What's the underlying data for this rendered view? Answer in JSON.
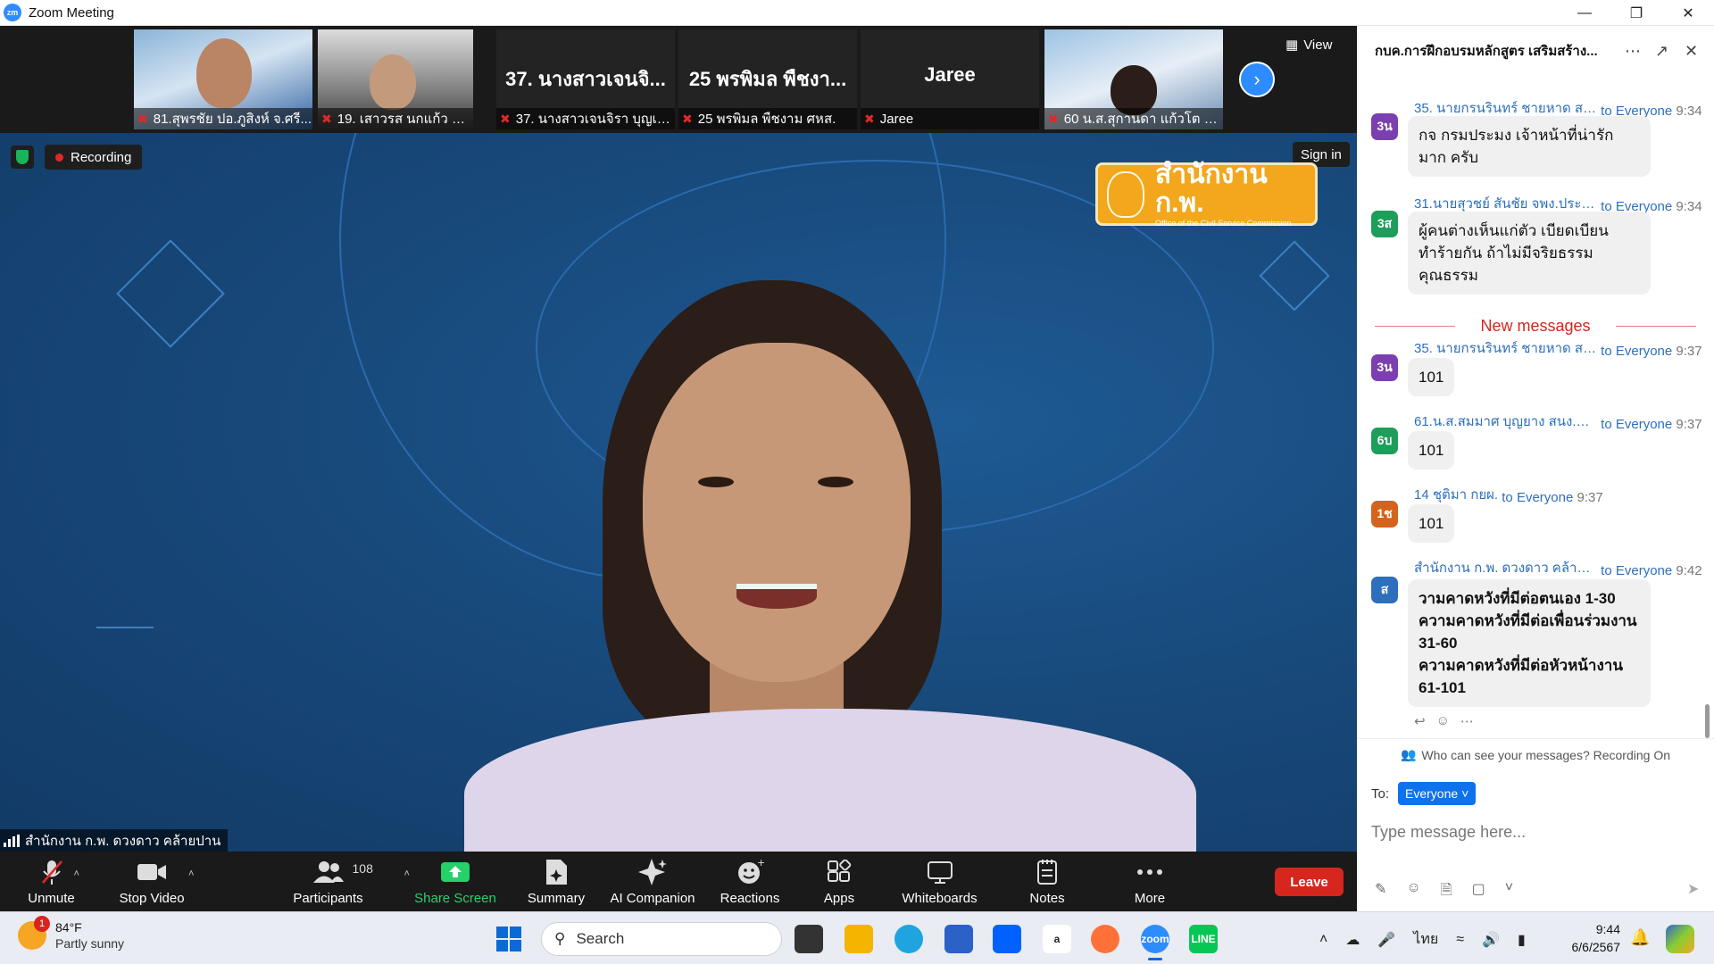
{
  "window": {
    "title": "Zoom Meeting",
    "app_logo_text": "zm",
    "controls": [
      "minimize-icon",
      "restore-icon",
      "close-icon"
    ]
  },
  "thumbnails": [
    {
      "id": "t1",
      "label": "81.สุพรชัย ปอ.ภูสิงห์ จ.ศรี...",
      "has_video": true,
      "muted": true
    },
    {
      "id": "t2",
      "label": "19. เสาวรส นกแก้ว  กอส.",
      "has_video": true,
      "muted": true
    },
    {
      "id": "t3",
      "big_name": "37. นางสาวเจนจิ...",
      "label": "37. นางสาวเจนจิรา บุญเลิ...",
      "has_video": false,
      "muted": true
    },
    {
      "id": "t4",
      "big_name": "25 พรพิมล  พืชงา...",
      "label": "25 พรพิมล  พืชงาม ศหส.",
      "has_video": false,
      "muted": true
    },
    {
      "id": "t5",
      "big_name": "Jaree",
      "label": "Jaree",
      "has_video": false,
      "muted": true
    },
    {
      "id": "t6",
      "label": "60 น.ส.สุกานดา แก้วโต ส...",
      "has_video": true,
      "muted": true
    }
  ],
  "strip": {
    "view_label": "View",
    "next_icon": "chevron-right-icon"
  },
  "main": {
    "recording_label": "Recording",
    "sign_in_label": "Sign in",
    "logo_text_th": "สำนักงาน ก.พ.",
    "logo_text_en": "Office of the Civil Service Commission",
    "speaker_name": "สำนักงาน ก.พ. ดวงดาว คล้ายปาน"
  },
  "toolbar": {
    "items": [
      {
        "key": "unmute",
        "label": "Unmute",
        "icon": "mic-muted-icon",
        "caret": true
      },
      {
        "key": "video",
        "label": "Stop Video",
        "icon": "video-camera-icon",
        "caret": true
      },
      {
        "key": "participants",
        "label": "Participants",
        "icon": "people-icon",
        "count": "108",
        "caret": true
      },
      {
        "key": "share",
        "label": "Share Screen",
        "icon": "share-screen-icon",
        "highlight": "#26d06a"
      },
      {
        "key": "summary",
        "label": "Summary",
        "icon": "summary-icon"
      },
      {
        "key": "ai",
        "label": "AI Companion",
        "icon": "sparkle-icon"
      },
      {
        "key": "reactions",
        "label": "Reactions",
        "icon": "smile-plus-icon"
      },
      {
        "key": "apps",
        "label": "Apps",
        "icon": "apps-icon"
      },
      {
        "key": "whiteboards",
        "label": "Whiteboards",
        "icon": "whiteboard-icon"
      },
      {
        "key": "notes",
        "label": "Notes",
        "icon": "notes-icon"
      },
      {
        "key": "more",
        "label": "More",
        "icon": "more-dots-icon"
      }
    ],
    "leave_label": "Leave"
  },
  "chat": {
    "title": "กบค.การฝึกอบรมหลักสูตร เสริมสร้าง...",
    "new_messages_label": "New messages",
    "messages": [
      {
        "avatar": "3น",
        "avatar_color": "#7b3fb0",
        "sender": "35. นายกรนรินทร์ ชายหาด สนง...",
        "to": "to Everyone",
        "time": "9:34",
        "text": "กจ กรมประมง เจ้าหน้าที่น่ารักมาก ครับ"
      },
      {
        "avatar": "3ส",
        "avatar_color": "#1e9e5a",
        "sender": "31.นายสุวชย์ สันชัย จพง.ประมง...",
        "to": "to Everyone",
        "time": "9:34",
        "text": "ผู้คนต่างเห็นแก่ตัว เบียดเบียนทำร้ายกัน ถ้าไม่มีจริยธรรม คุณธรรม"
      },
      {
        "avatar": "3น",
        "avatar_color": "#7b3fb0",
        "sender": "35. นายกรนรินทร์ ชายหาด สนง...",
        "to": "to Everyone",
        "time": "9:37",
        "text": "101"
      },
      {
        "avatar": "6บ",
        "avatar_color": "#1e9e5a",
        "sender": "61.น.ส.สมมาศ บุญยาง สนง.ประ...",
        "to": "to Everyone",
        "time": "9:37",
        "text": "101"
      },
      {
        "avatar": "1ช",
        "avatar_color": "#d4631c",
        "sender": "14 ชุติมา กยผ.",
        "to": "to Everyone",
        "time": "9:37",
        "text": "101"
      },
      {
        "avatar": "ส",
        "avatar_color": "#2d6fbd",
        "sender": "สำนักงาน ก.พ. ดวงดาว คล้ายปาน",
        "to": "to Everyone",
        "time": "9:42",
        "text": "วามคาดหวังที่มีต่อตนเอง 1-30\nความคาดหวังที่มีต่อเพื่อนร่วมงาน 31-60\nความคาดหวังที่มีต่อหัวหน้างาน 61-101"
      }
    ],
    "visibility_note": "Who can see your messages? Recording On",
    "to_label": "To:",
    "recipient": "Everyone",
    "input_placeholder": "Type message here..."
  },
  "taskbar": {
    "weather_temp": "84°F",
    "weather_condition": "Partly sunny",
    "weather_badge": "1",
    "search_label": "Search",
    "language": "ไทย",
    "time": "9:44",
    "date": "6/6/2567"
  }
}
